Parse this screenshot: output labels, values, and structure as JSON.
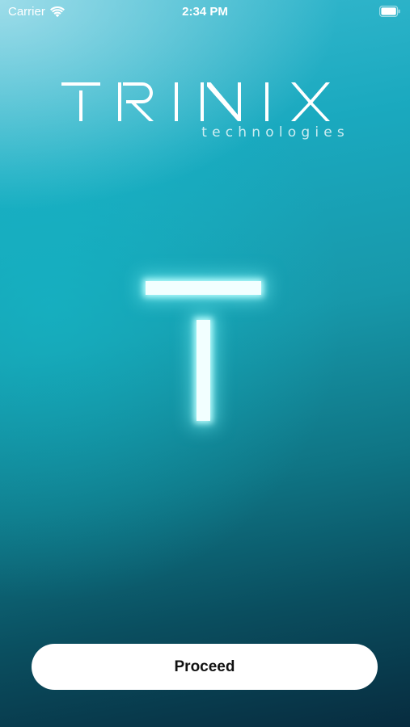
{
  "status_bar": {
    "carrier": "Carrier",
    "time": "2:34 PM",
    "wifi_icon": "wifi-icon",
    "battery_icon": "battery-icon"
  },
  "logo": {
    "wordmark": "TRINIX",
    "subtitle": "technologies"
  },
  "emblem": {
    "icon": "glowing-t-icon",
    "glow_color": "#bfffff"
  },
  "actions": {
    "proceed_label": "Proceed"
  },
  "colors": {
    "background_top": "#38b9cf",
    "background_bottom": "#072c3f",
    "button_background": "#ffffff",
    "button_text": "#111111"
  }
}
